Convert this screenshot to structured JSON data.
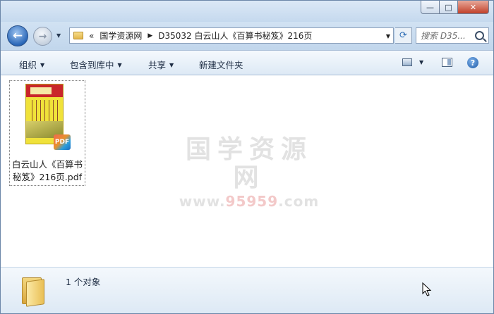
{
  "window": {
    "min_symbol": "—",
    "max_symbol": "□",
    "close_symbol": "✕"
  },
  "nav": {
    "back_icon": "←",
    "forward_icon": "→",
    "recent_icon": "▼"
  },
  "address": {
    "overflow": "«",
    "crumbs": [
      "国学资源网",
      "D35032 白云山人《百算书秘笈》216页"
    ],
    "separator": "▶",
    "dropdown": "▼",
    "refresh_icon": "⟳"
  },
  "search": {
    "placeholder": "搜索 D35..."
  },
  "toolbar": {
    "organize": "组织",
    "include_library": "包含到库中",
    "share": "共享",
    "new_folder": "新建文件夹",
    "caret": "▼",
    "help": "?"
  },
  "file": {
    "name": "白云山人《百算书秘笈》216页.pdf",
    "badge": "PDF"
  },
  "watermark": {
    "main": "国学资源网",
    "sub_prefix": "www.",
    "sub_highlight": "95959",
    "sub_suffix": ".com"
  },
  "status": {
    "count_text": "1 个对象"
  },
  "colors": {
    "accent": "#2a67b8",
    "close": "#c2412a",
    "book_cover": "#f0e23a",
    "book_band": "#c9262a"
  }
}
